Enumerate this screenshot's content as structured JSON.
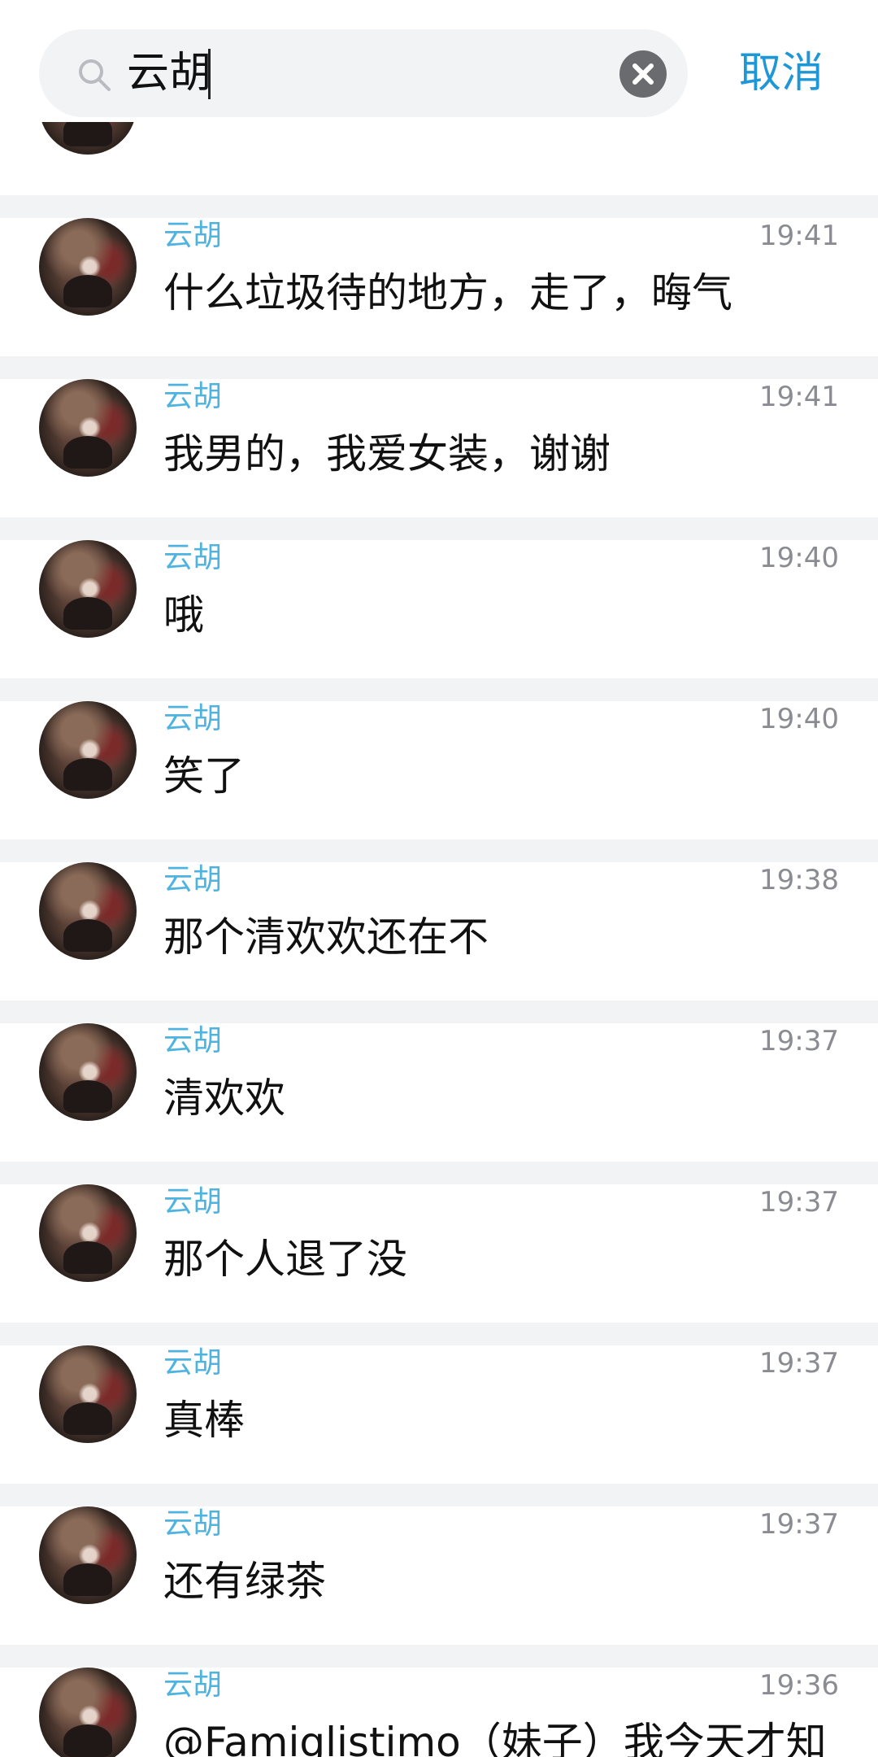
{
  "search": {
    "query": "云胡",
    "cancel_label": "取消"
  },
  "results": [
    {
      "sender": "云胡",
      "time": "19:41",
      "message": "什么垃圾待的地方，走了，晦气"
    },
    {
      "sender": "云胡",
      "time": "19:41",
      "message": "我男的，我爱女装，谢谢"
    },
    {
      "sender": "云胡",
      "time": "19:40",
      "message": "哦"
    },
    {
      "sender": "云胡",
      "time": "19:40",
      "message": "笑了"
    },
    {
      "sender": "云胡",
      "time": "19:38",
      "message": "那个清欢欢还在不"
    },
    {
      "sender": "云胡",
      "time": "19:37",
      "message": "清欢欢"
    },
    {
      "sender": "云胡",
      "time": "19:37",
      "message": "那个人退了没"
    },
    {
      "sender": "云胡",
      "time": "19:37",
      "message": "真棒"
    },
    {
      "sender": "云胡",
      "time": "19:37",
      "message": "还有绿茶"
    },
    {
      "sender": "云胡",
      "time": "19:36",
      "message": "@Famiglistimo（妹子）我今天才知"
    }
  ],
  "colors": {
    "accent": "#1e97d6",
    "sender": "#4fb3e0",
    "background": "#f2f3f5"
  },
  "icons": {
    "search": "search-icon",
    "clear": "clear-icon"
  }
}
